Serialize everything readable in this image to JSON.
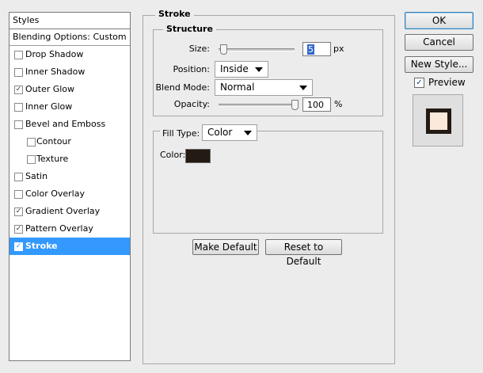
{
  "styles_panel": {
    "header": "Styles",
    "blending_header": "Blending Options: Custom",
    "items": [
      {
        "label": "Drop Shadow",
        "checked": false,
        "level": 0,
        "mark": ""
      },
      {
        "label": "Inner Shadow",
        "checked": false,
        "level": 0,
        "mark": ""
      },
      {
        "label": "Outer Glow",
        "checked": true,
        "level": 0,
        "mark": "✓"
      },
      {
        "label": "Inner Glow",
        "checked": false,
        "level": 0,
        "mark": ""
      },
      {
        "label": "Bevel and Emboss",
        "checked": false,
        "level": 0,
        "mark": ""
      },
      {
        "label": "Contour",
        "checked": false,
        "level": 1,
        "mark": ""
      },
      {
        "label": "Texture",
        "checked": false,
        "level": 1,
        "mark": ""
      },
      {
        "label": "Satin",
        "checked": false,
        "level": 0,
        "mark": ""
      },
      {
        "label": "Color Overlay",
        "checked": false,
        "level": 0,
        "mark": ""
      },
      {
        "label": "Gradient Overlay",
        "checked": true,
        "level": 0,
        "mark": "✓"
      },
      {
        "label": "Pattern Overlay",
        "checked": true,
        "level": 0,
        "mark": "✓"
      },
      {
        "label": "Stroke",
        "checked": true,
        "level": 0,
        "mark": "✓",
        "selected": true
      }
    ]
  },
  "stroke": {
    "title": "Stroke",
    "structure": {
      "title": "Structure",
      "size_label": "Size:",
      "size_value": "5",
      "size_unit": "px",
      "size_fraction": 0.02,
      "position_label": "Position:",
      "position_value": "Inside",
      "blend_mode_label": "Blend Mode:",
      "blend_mode_value": "Normal",
      "opacity_label": "Opacity:",
      "opacity_value": "100",
      "opacity_unit": "%",
      "opacity_fraction": 1.0
    },
    "fill": {
      "fill_type_label": "Fill Type:",
      "fill_type_value": "Color",
      "color_label": "Color:",
      "color_hex": "#231a14"
    },
    "make_default_label": "Make Default",
    "reset_default_label": "Reset to Default"
  },
  "actions": {
    "ok_label": "OK",
    "cancel_label": "Cancel",
    "new_style_label": "New Style...",
    "preview_label": "Preview",
    "preview_checked": true
  },
  "colors": {
    "selection": "#3399ff",
    "preview_fill": "#fbe9d9",
    "stroke_color": "#231a14"
  }
}
